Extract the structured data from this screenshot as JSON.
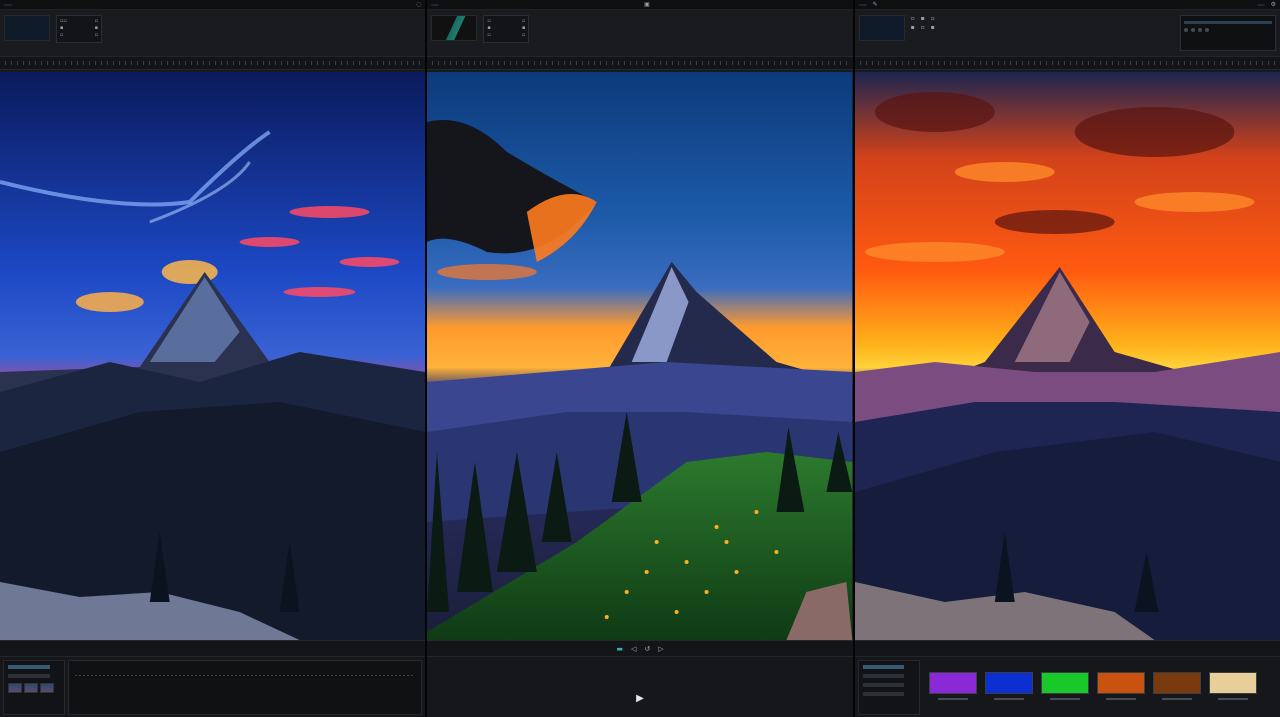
{
  "panels": [
    {
      "id": "left",
      "titlebar_chip": "",
      "viewer": "night-blue grade"
    },
    {
      "id": "center",
      "titlebar_chip": "",
      "viewer": "golden sunset grade"
    },
    {
      "id": "right",
      "titlebar_chip": "",
      "viewer": "fiery orange grade"
    }
  ],
  "colors": {
    "accent": "#2bb5a8",
    "panel_bg": "#17181b",
    "chrome_bg": "#0e0f11"
  },
  "icons": {
    "play": "play-icon",
    "settings": "gear-icon",
    "lock": "lock-icon",
    "pen": "pen-icon"
  },
  "presets": [
    {
      "name": "",
      "color": "#8a2ad6"
    },
    {
      "name": "",
      "color": "#0b2fd0"
    },
    {
      "name": "",
      "color": "#19c92b"
    },
    {
      "name": "",
      "color": "#c9520f"
    },
    {
      "name": "",
      "color": "#7a3a10"
    },
    {
      "name": "",
      "color": "#e8cf9a"
    }
  ]
}
